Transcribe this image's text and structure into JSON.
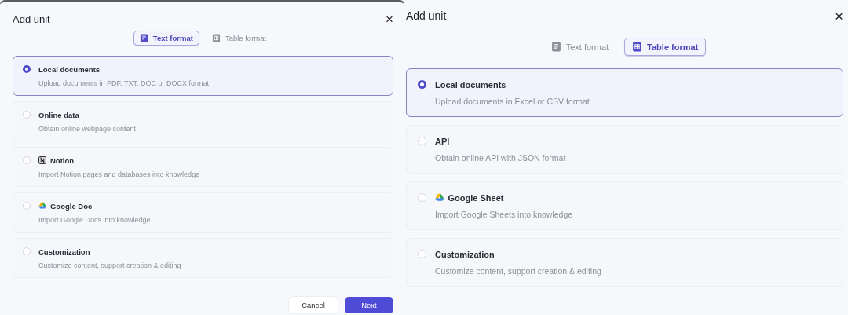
{
  "panels": [
    {
      "title": "Add unit",
      "close": "×",
      "tabs": [
        {
          "label": "Text format",
          "selected": true,
          "kind": "text"
        },
        {
          "label": "Table format",
          "selected": false,
          "kind": "table"
        }
      ],
      "options": [
        {
          "title": "Local documents",
          "description": "Upload documents in PDF, TXT, DOC or DOCX format",
          "selected": true
        },
        {
          "title": "Online data",
          "description": "Obtain online webpage content",
          "selected": false
        },
        {
          "title": "Notion",
          "description": "Import Notion pages and databases into knowledge",
          "selected": false,
          "kind": "notion"
        },
        {
          "title": "Google Doc",
          "description": "Import Google Docs into knowledge",
          "selected": false,
          "kind": "drive"
        },
        {
          "title": "Customization",
          "description": "Customize content, support creation & editing",
          "selected": false
        }
      ],
      "buttons": [
        {
          "label": "Cancel",
          "kind": "secondary"
        },
        {
          "label": "Next",
          "kind": "primary"
        }
      ]
    },
    {
      "title": "Add unit",
      "close": "×",
      "tabs": [
        {
          "label": "Text format",
          "selected": false,
          "kind": "text"
        },
        {
          "label": "Table format",
          "selected": true,
          "kind": "table"
        }
      ],
      "options": [
        {
          "title": "Local documents",
          "description": "Upload documents in Excel or CSV format",
          "selected": true
        },
        {
          "title": "API",
          "description": "Obtain online API with JSON format",
          "selected": false
        },
        {
          "title": "Google Sheet",
          "description": "Import Google Sheets into knowledge",
          "selected": false,
          "kind": "drive"
        },
        {
          "title": "Customization",
          "description": "Customize content, support creation & editing",
          "selected": false
        }
      ]
    }
  ]
}
